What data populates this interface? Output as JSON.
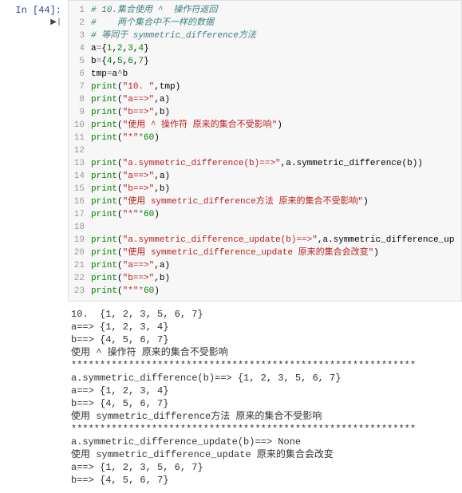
{
  "prompt": {
    "label": "In [44]:"
  },
  "code": {
    "lines": [
      {
        "n": "1",
        "tokens": [
          {
            "t": "# 10.集合使用 ^  操作符返回",
            "c": "c-green"
          }
        ]
      },
      {
        "n": "2",
        "tokens": [
          {
            "t": "#    两个集合中不一样的数据",
            "c": "c-green"
          }
        ]
      },
      {
        "n": "3",
        "tokens": [
          {
            "t": "# 等同于 symmetric_difference方法",
            "c": "c-green"
          }
        ]
      },
      {
        "n": "4",
        "tokens": [
          {
            "t": "a",
            "c": "c-name"
          },
          {
            "t": "=",
            "c": "c-op"
          },
          {
            "t": "{",
            "c": "c-name"
          },
          {
            "t": "1",
            "c": "c-num"
          },
          {
            "t": ",",
            "c": "c-name"
          },
          {
            "t": "2",
            "c": "c-num"
          },
          {
            "t": ",",
            "c": "c-name"
          },
          {
            "t": "3",
            "c": "c-num"
          },
          {
            "t": ",",
            "c": "c-name"
          },
          {
            "t": "4",
            "c": "c-num"
          },
          {
            "t": "}",
            "c": "c-name"
          }
        ]
      },
      {
        "n": "5",
        "tokens": [
          {
            "t": "b",
            "c": "c-name"
          },
          {
            "t": "=",
            "c": "c-op"
          },
          {
            "t": "{",
            "c": "c-name"
          },
          {
            "t": "4",
            "c": "c-num"
          },
          {
            "t": ",",
            "c": "c-name"
          },
          {
            "t": "5",
            "c": "c-num"
          },
          {
            "t": ",",
            "c": "c-name"
          },
          {
            "t": "6",
            "c": "c-num"
          },
          {
            "t": ",",
            "c": "c-name"
          },
          {
            "t": "7",
            "c": "c-num"
          },
          {
            "t": "}",
            "c": "c-name"
          }
        ]
      },
      {
        "n": "6",
        "tokens": [
          {
            "t": "tmp",
            "c": "c-name"
          },
          {
            "t": "=",
            "c": "c-op"
          },
          {
            "t": "a",
            "c": "c-name"
          },
          {
            "t": "^",
            "c": "c-op"
          },
          {
            "t": "b",
            "c": "c-name"
          }
        ]
      },
      {
        "n": "7",
        "tokens": [
          {
            "t": "print",
            "c": "c-builtin"
          },
          {
            "t": "(",
            "c": "c-name"
          },
          {
            "t": "\"10. \"",
            "c": "c-str"
          },
          {
            "t": ",tmp)",
            "c": "c-name"
          }
        ]
      },
      {
        "n": "8",
        "tokens": [
          {
            "t": "print",
            "c": "c-builtin"
          },
          {
            "t": "(",
            "c": "c-name"
          },
          {
            "t": "\"a==>\"",
            "c": "c-str"
          },
          {
            "t": ",a)",
            "c": "c-name"
          }
        ]
      },
      {
        "n": "9",
        "tokens": [
          {
            "t": "print",
            "c": "c-builtin"
          },
          {
            "t": "(",
            "c": "c-name"
          },
          {
            "t": "\"b==>\"",
            "c": "c-str"
          },
          {
            "t": ",b)",
            "c": "c-name"
          }
        ]
      },
      {
        "n": "10",
        "tokens": [
          {
            "t": "print",
            "c": "c-builtin"
          },
          {
            "t": "(",
            "c": "c-name"
          },
          {
            "t": "\"使用 ^ 操作符 原来的集合不受影响\"",
            "c": "c-str"
          },
          {
            "t": ")",
            "c": "c-name"
          }
        ]
      },
      {
        "n": "11",
        "tokens": [
          {
            "t": "print",
            "c": "c-builtin"
          },
          {
            "t": "(",
            "c": "c-name"
          },
          {
            "t": "\"*\"",
            "c": "c-str"
          },
          {
            "t": "*",
            "c": "c-op"
          },
          {
            "t": "60",
            "c": "c-num"
          },
          {
            "t": ")",
            "c": "c-name"
          }
        ]
      },
      {
        "n": "12",
        "tokens": [
          {
            "t": " ",
            "c": "c-name"
          }
        ]
      },
      {
        "n": "13",
        "tokens": [
          {
            "t": "print",
            "c": "c-builtin"
          },
          {
            "t": "(",
            "c": "c-name"
          },
          {
            "t": "\"a.symmetric_difference(b)==>\"",
            "c": "c-str"
          },
          {
            "t": ",a.symmetric_difference(b))",
            "c": "c-name"
          }
        ]
      },
      {
        "n": "14",
        "tokens": [
          {
            "t": "print",
            "c": "c-builtin"
          },
          {
            "t": "(",
            "c": "c-name"
          },
          {
            "t": "\"a==>\"",
            "c": "c-str"
          },
          {
            "t": ",a)",
            "c": "c-name"
          }
        ]
      },
      {
        "n": "15",
        "tokens": [
          {
            "t": "print",
            "c": "c-builtin"
          },
          {
            "t": "(",
            "c": "c-name"
          },
          {
            "t": "\"b==>\"",
            "c": "c-str"
          },
          {
            "t": ",b)",
            "c": "c-name"
          }
        ]
      },
      {
        "n": "16",
        "tokens": [
          {
            "t": "print",
            "c": "c-builtin"
          },
          {
            "t": "(",
            "c": "c-name"
          },
          {
            "t": "\"使用 symmetric_difference方法 原来的集合不受影响\"",
            "c": "c-str"
          },
          {
            "t": ")",
            "c": "c-name"
          }
        ]
      },
      {
        "n": "17",
        "tokens": [
          {
            "t": "print",
            "c": "c-builtin"
          },
          {
            "t": "(",
            "c": "c-name"
          },
          {
            "t": "\"*\"",
            "c": "c-str"
          },
          {
            "t": "*",
            "c": "c-op"
          },
          {
            "t": "60",
            "c": "c-num"
          },
          {
            "t": ")",
            "c": "c-name"
          }
        ]
      },
      {
        "n": "18",
        "tokens": [
          {
            "t": " ",
            "c": "c-name"
          }
        ]
      },
      {
        "n": "19",
        "tokens": [
          {
            "t": "print",
            "c": "c-builtin"
          },
          {
            "t": "(",
            "c": "c-name"
          },
          {
            "t": "\"a.symmetric_difference_update(b)==>\"",
            "c": "c-str"
          },
          {
            "t": ",a.symmetric_difference_up",
            "c": "c-name"
          }
        ]
      },
      {
        "n": "20",
        "tokens": [
          {
            "t": "print",
            "c": "c-builtin"
          },
          {
            "t": "(",
            "c": "c-name"
          },
          {
            "t": "\"使用 symmetric_difference_update 原来的集合会改变\"",
            "c": "c-str"
          },
          {
            "t": ")",
            "c": "c-name"
          }
        ]
      },
      {
        "n": "21",
        "tokens": [
          {
            "t": "print",
            "c": "c-builtin"
          },
          {
            "t": "(",
            "c": "c-name"
          },
          {
            "t": "\"a==>\"",
            "c": "c-str"
          },
          {
            "t": ",a)",
            "c": "c-name"
          }
        ]
      },
      {
        "n": "22",
        "tokens": [
          {
            "t": "print",
            "c": "c-builtin"
          },
          {
            "t": "(",
            "c": "c-name"
          },
          {
            "t": "\"b==>\"",
            "c": "c-str"
          },
          {
            "t": ",b)",
            "c": "c-name"
          }
        ]
      },
      {
        "n": "23",
        "tokens": [
          {
            "t": "print",
            "c": "c-builtin"
          },
          {
            "t": "(",
            "c": "c-name"
          },
          {
            "t": "\"*\"",
            "c": "c-str"
          },
          {
            "t": "*",
            "c": "c-op"
          },
          {
            "t": "60",
            "c": "c-num"
          },
          {
            "t": ")",
            "c": "c-name"
          }
        ]
      }
    ]
  },
  "output": {
    "lines": [
      "10.  {1, 2, 3, 5, 6, 7}",
      "a==> {1, 2, 3, 4}",
      "b==> {4, 5, 6, 7}",
      "使用 ^ 操作符 原来的集合不受影响",
      "************************************************************",
      "a.symmetric_difference(b)==> {1, 2, 3, 5, 6, 7}",
      "a==> {1, 2, 3, 4}",
      "b==> {4, 5, 6, 7}",
      "使用 symmetric_difference方法 原来的集合不受影响",
      "************************************************************",
      "a.symmetric_difference_update(b)==> None",
      "使用 symmetric_difference_update 原来的集合会改变",
      "a==> {1, 2, 3, 5, 6, 7}",
      "b==> {4, 5, 6, 7}"
    ]
  }
}
